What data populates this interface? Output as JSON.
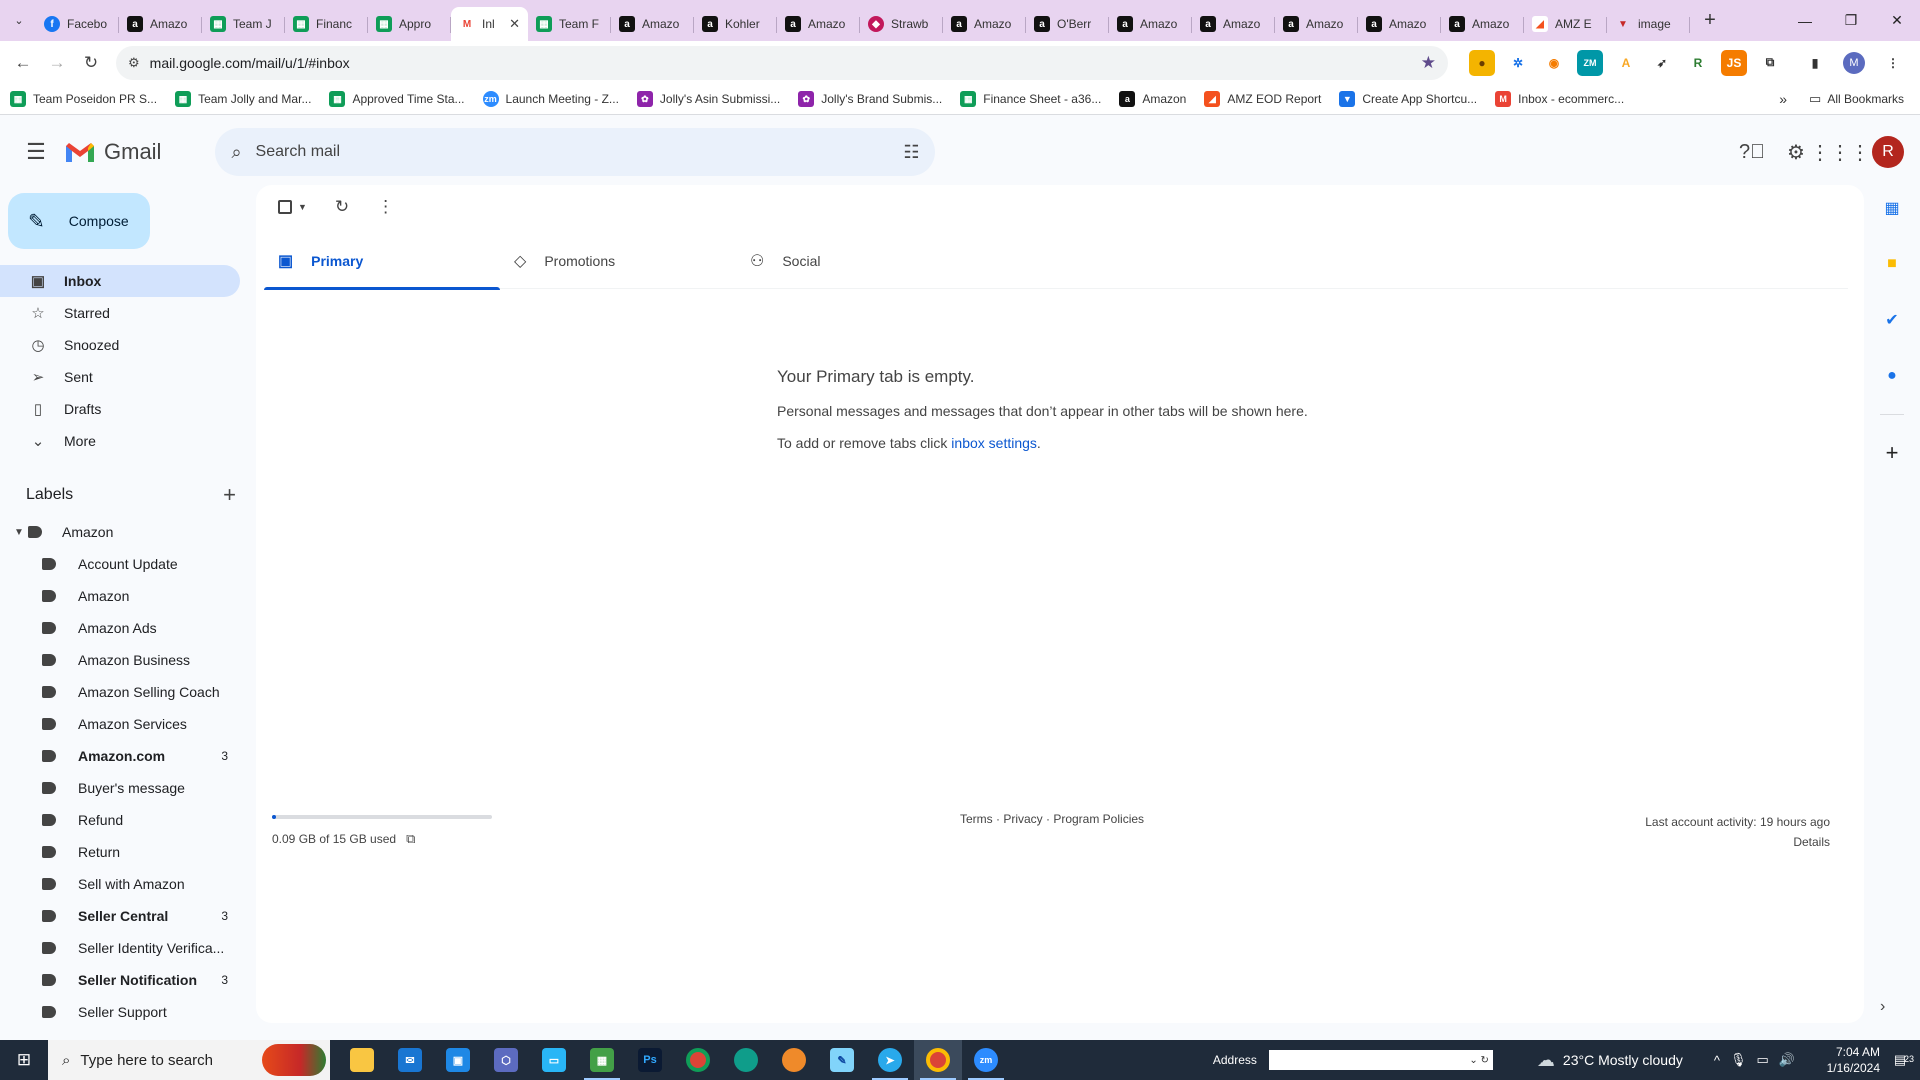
{
  "browser": {
    "tabs": [
      {
        "title": "Facebo",
        "favicon": "facebook-icon"
      },
      {
        "title": "Amazo",
        "favicon": "amazon-icon"
      },
      {
        "title": "Team J",
        "favicon": "sheets-icon"
      },
      {
        "title": "Financ",
        "favicon": "sheets-icon"
      },
      {
        "title": "Appro",
        "favicon": "sheets-icon"
      },
      {
        "title": "Inl",
        "favicon": "gmail-icon",
        "active": true
      },
      {
        "title": "Team F",
        "favicon": "sheets-icon"
      },
      {
        "title": "Amazo",
        "favicon": "amazon-icon"
      },
      {
        "title": "Kohler",
        "favicon": "amazon-icon"
      },
      {
        "title": "Amazo",
        "favicon": "amazon-icon"
      },
      {
        "title": "Strawb",
        "favicon": "shield-icon"
      },
      {
        "title": "Amazo",
        "favicon": "amazon-icon"
      },
      {
        "title": "O'Berr",
        "favicon": "amazon-icon"
      },
      {
        "title": "Amazo",
        "favicon": "amazon-icon"
      },
      {
        "title": "Amazo",
        "favicon": "amazon-icon"
      },
      {
        "title": "Amazo",
        "favicon": "amazon-icon"
      },
      {
        "title": "Amazo",
        "favicon": "amazon-icon"
      },
      {
        "title": "Amazo",
        "favicon": "amazon-icon"
      },
      {
        "title": "AMZ E",
        "favicon": "amz-icon"
      },
      {
        "title": "image",
        "favicon": "image-icon"
      }
    ],
    "url": "mail.google.com/mail/u/1/#inbox",
    "bookmarks": [
      {
        "label": "Team Poseidon PR S...",
        "icon": "sheets-icon"
      },
      {
        "label": "Team Jolly and Mar...",
        "icon": "sheets-icon"
      },
      {
        "label": "Approved Time Sta...",
        "icon": "sheets-icon"
      },
      {
        "label": "Launch Meeting - Z...",
        "icon": "zoom-icon"
      },
      {
        "label": "Jolly's Asin Submissi...",
        "icon": "form-icon"
      },
      {
        "label": "Jolly's Brand Submis...",
        "icon": "form-icon"
      },
      {
        "label": "Finance Sheet - a36...",
        "icon": "sheets-icon"
      },
      {
        "label": "Amazon",
        "icon": "amazon-icon"
      },
      {
        "label": "AMZ EOD Report",
        "icon": "amz-icon"
      },
      {
        "label": "Create App Shortcu...",
        "icon": "app-icon"
      },
      {
        "label": "Inbox - ecommerc...",
        "icon": "gmail-icon"
      }
    ],
    "all_bookmarks": "All Bookmarks"
  },
  "gmail": {
    "brand": "Gmail",
    "search_placeholder": "Search mail",
    "avatar_letter": "R",
    "compose": "Compose",
    "nav": [
      {
        "label": "Inbox",
        "icon": "inbox-icon",
        "active": true
      },
      {
        "label": "Starred",
        "icon": "star-icon"
      },
      {
        "label": "Snoozed",
        "icon": "clock-icon"
      },
      {
        "label": "Sent",
        "icon": "send-icon"
      },
      {
        "label": "Drafts",
        "icon": "draft-icon"
      },
      {
        "label": "More",
        "icon": "chevron-down-icon"
      }
    ],
    "labels_title": "Labels",
    "labels": [
      {
        "name": "Amazon",
        "level": "top",
        "count": ""
      },
      {
        "name": "Account Update",
        "level": "sub",
        "count": ""
      },
      {
        "name": "Amazon",
        "level": "sub",
        "count": ""
      },
      {
        "name": "Amazon Ads",
        "level": "sub",
        "count": ""
      },
      {
        "name": "Amazon Business",
        "level": "sub",
        "count": ""
      },
      {
        "name": "Amazon Selling Coach",
        "level": "sub",
        "count": ""
      },
      {
        "name": "Amazon Services",
        "level": "sub",
        "count": ""
      },
      {
        "name": "Amazon.com",
        "level": "sub",
        "count": "3",
        "bold": true
      },
      {
        "name": "Buyer's message",
        "level": "sub",
        "count": ""
      },
      {
        "name": "Refund",
        "level": "sub",
        "count": ""
      },
      {
        "name": "Return",
        "level": "sub",
        "count": ""
      },
      {
        "name": "Sell with Amazon",
        "level": "sub",
        "count": ""
      },
      {
        "name": "Seller Central",
        "level": "sub",
        "count": "3",
        "bold": true
      },
      {
        "name": "Seller Identity Verifica...",
        "level": "sub",
        "count": ""
      },
      {
        "name": "Seller Notification",
        "level": "sub",
        "count": "3",
        "bold": true
      },
      {
        "name": "Seller Support",
        "level": "sub",
        "count": ""
      }
    ],
    "tabs": [
      {
        "label": "Primary",
        "icon": "inbox-icon",
        "active": true
      },
      {
        "label": "Promotions",
        "icon": "tag-icon"
      },
      {
        "label": "Social",
        "icon": "people-icon"
      }
    ],
    "empty": {
      "heading": "Your Primary tab is empty.",
      "line1": "Personal messages and messages that don’t appear in other tabs will be shown here.",
      "line2_prefix": "To add or remove tabs click ",
      "line2_link": "inbox settings",
      "line2_suffix": "."
    },
    "storage": {
      "text": "0.09 GB of 15 GB used",
      "fraction": 0.006
    },
    "footer_links": "Terms · Privacy · Program Policies",
    "last_activity": "Last account activity: 19 hours ago",
    "details": "Details"
  },
  "taskbar": {
    "search_placeholder": "Type here to search",
    "address_label": "Address",
    "weather": "23°C  Mostly cloudy",
    "time": "7:04 AM",
    "date": "1/16/2024",
    "notification_count": "23"
  }
}
